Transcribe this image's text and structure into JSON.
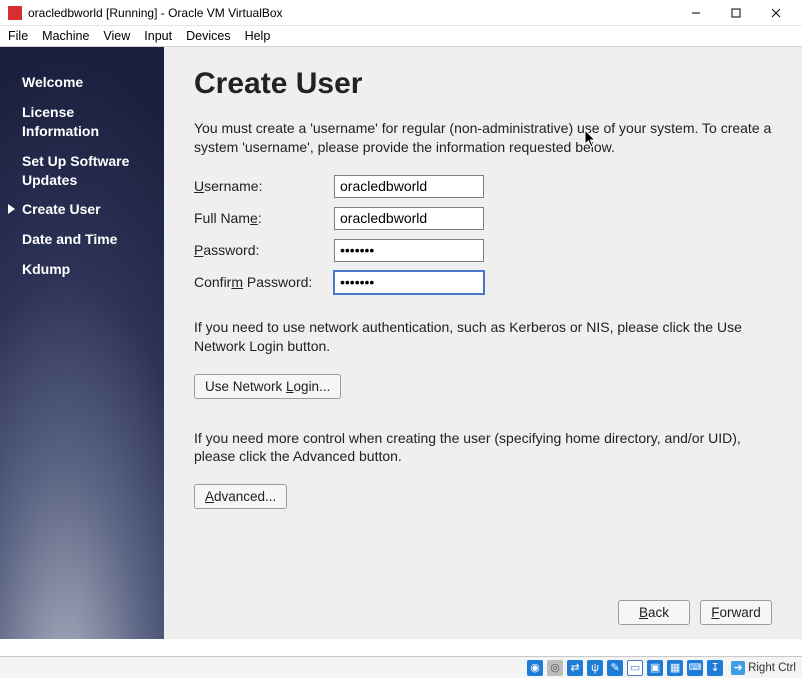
{
  "window": {
    "title": "oracledbworld [Running] - Oracle VM VirtualBox"
  },
  "menu": {
    "file": "File",
    "machine": "Machine",
    "view": "View",
    "input": "Input",
    "devices": "Devices",
    "help": "Help"
  },
  "sidebar": {
    "items": [
      "Welcome",
      "License Information",
      "Set Up Software Updates",
      "Create User",
      "Date and Time",
      "Kdump"
    ],
    "active_index": 3
  },
  "page": {
    "heading": "Create User",
    "intro": "You must create a 'username' for regular (non-administrative) use of your system.  To create a system 'username', please provide the information requested below.",
    "labels": {
      "username_pre": "U",
      "username_post": "sername:",
      "fullname_pre": "Full Nam",
      "fullname_u": "e",
      "fullname_post": ":",
      "password_u": "P",
      "password_post": "assword:",
      "confirm_pre": "Confir",
      "confirm_u": "m",
      "confirm_post": " Password:"
    },
    "fields": {
      "username": "oracledbworld",
      "fullname": "oracledbworld",
      "password": "•••••••",
      "confirm": "•••••••"
    },
    "net_text": "If you need to use network authentication, such as Kerberos or NIS, please click the Use Network Login button.",
    "net_button_pre": "Use Network ",
    "net_button_u": "L",
    "net_button_post": "ogin...",
    "adv_text": "If you need more control when creating the user (specifying home directory, and/or UID), please click the Advanced button.",
    "adv_button_u": "A",
    "adv_button_post": "dvanced...",
    "back_u": "B",
    "back_post": "ack",
    "forward_u": "F",
    "forward_post": "orward"
  },
  "status": {
    "host_key": "Right Ctrl"
  }
}
